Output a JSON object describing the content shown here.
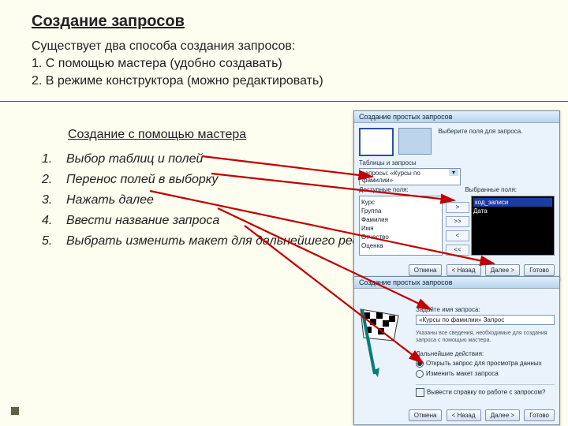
{
  "title": "Создание запросов",
  "intro": {
    "line0": "Существует два способа создания запросов:",
    "line1": "1.  С помощью мастера (удобно создавать)",
    "line2": "2.  В режиме конструктора (можно редактировать)"
  },
  "sub_title": "Создание  с помощью мастера",
  "steps": [
    {
      "n": "1.",
      "t": "Выбор таблиц и полей"
    },
    {
      "n": "2.",
      "t": "Перенос полей в выборку"
    },
    {
      "n": "3.",
      "t": "Нажать далее"
    },
    {
      "n": "4.",
      "t": "Ввести название запроса"
    },
    {
      "n": "5.",
      "t": "Выбрать изменить макет для дальнейшего редактирования запроса"
    }
  ],
  "panel1": {
    "title": "Создание простых запросов",
    "hint": "Выберите поля для запроса.",
    "table_label": "Таблицы и запросы",
    "dropdown": "запросы: «Курсы по фамилии»",
    "left_label": "Доступные поля:",
    "right_label": "Выбранные поля:",
    "left_items": [
      "Курс",
      "Группа",
      "Фамилия",
      "Имя",
      "Отчество",
      "Оценка"
    ],
    "right_items": [
      "код_записи",
      "Дата"
    ],
    "mid_btns": [
      ">",
      ">>",
      "<",
      "<<"
    ],
    "buttons": [
      "Отмена",
      "< Назад",
      "Далее >",
      "Готово"
    ]
  },
  "panel2": {
    "title": "Создание простых запросов",
    "name_label": "Задайте имя запроса:",
    "name_value": "«Курсы по фамилии» Запрос",
    "hint": "Указаны все сведения, необходимые для создания запроса с помощью мастера.",
    "hint2": "Дальнейшие действия:",
    "radio1": "Открыть запрос для просмотра данных",
    "radio2": "Изменить макет запроса",
    "chk": "Вывести справку по работе с запросом?",
    "buttons": [
      "Отмена",
      "< Назад",
      "Далее >",
      "Готово"
    ]
  }
}
